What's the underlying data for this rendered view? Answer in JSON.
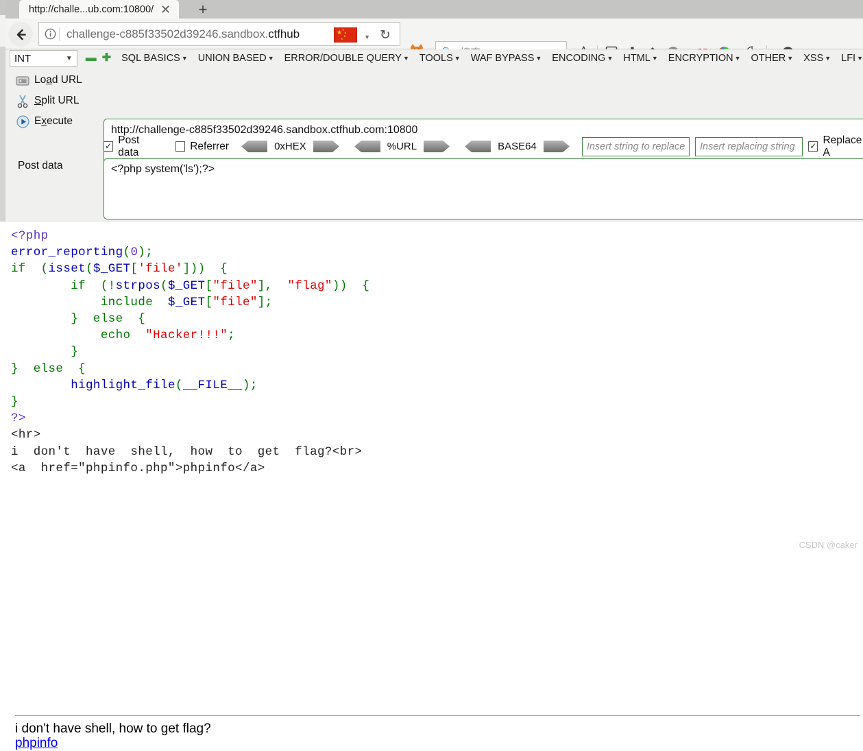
{
  "browser": {
    "tab": {
      "title": "http://challe...ub.com:10800/",
      "close_icon": "close-icon",
      "new_tab_icon": "plus-icon"
    },
    "nav": {
      "back_icon": "back-arrow-icon",
      "info_icon": "info-circle-icon",
      "url_prefix": "challenge-c885f33502d39246.sandbox.",
      "url_suffix": "ctfhub",
      "flag_icon": "china-flag-icon",
      "flag_caret": "chevron-down-icon",
      "reload_icon": "reload-icon",
      "hackbar_toggle_icon": "hackbar-fox-icon"
    },
    "search": {
      "icon": "search-icon",
      "placeholder": "搜索"
    },
    "toolbar_icons": [
      {
        "name": "bookmark-star-icon",
        "glyph": "☆"
      },
      {
        "name": "library-icon",
        "glyph": "▤"
      },
      {
        "name": "downloads-icon",
        "glyph": "⬇"
      },
      {
        "name": "home-icon",
        "glyph": "⌂"
      },
      {
        "name": "extension-gray-icon",
        "glyph": "●"
      },
      {
        "name": "js-switch-icon",
        "glyph": "JS"
      },
      {
        "name": "firebug-icon",
        "glyph": "●"
      },
      {
        "name": "cookie-manager-icon",
        "glyph": "○"
      },
      {
        "name": "proxy-switch-icon",
        "glyph": "●"
      }
    ]
  },
  "hackbar": {
    "type_select": {
      "value": "INT",
      "caret_icon": "chevron-down-icon"
    },
    "minus_icon": "minus-icon",
    "plus_icon": "plus-icon",
    "menu": [
      {
        "label": "SQL BASICS",
        "caret": "▾"
      },
      {
        "label": "UNION BASED",
        "caret": "▾"
      },
      {
        "label": "ERROR/DOUBLE QUERY",
        "caret": "▾"
      },
      {
        "label": "TOOLS",
        "caret": "▾"
      },
      {
        "label": "WAF BYPASS",
        "caret": "▾"
      },
      {
        "label": "ENCODING",
        "caret": "▾"
      },
      {
        "label": "HTML",
        "caret": "▾"
      },
      {
        "label": "ENCRYPTION",
        "caret": "▾"
      },
      {
        "label": "OTHER",
        "caret": "▾"
      },
      {
        "label": "XSS",
        "caret": "▾"
      },
      {
        "label": "LFI",
        "caret": "▾"
      }
    ],
    "side_actions": [
      {
        "icon": "load-url-icon",
        "pre": "Lo",
        "accel": "a",
        "post": "d URL"
      },
      {
        "icon": "split-url-scissors-icon",
        "pre": "",
        "accel": "S",
        "post": "plit URL"
      },
      {
        "icon": "execute-play-icon",
        "pre": "E",
        "accel": "x",
        "post": "ecute"
      }
    ],
    "url_value": "http://challenge-c885f33502d39246.sandbox.ctfhub.com:10800",
    "options": {
      "post_data": {
        "label": "Post data",
        "checked": true
      },
      "referrer": {
        "label": "Referrer",
        "checked": false
      },
      "encoders": [
        "0xHEX",
        "%URL",
        "BASE64"
      ],
      "replace_search": {
        "placeholder": "Insert string to replace"
      },
      "replace_with": {
        "placeholder": "Insert replacing string"
      },
      "replace_all": {
        "label": "Replace A",
        "checked": true
      }
    },
    "post_label": "Post data",
    "post_value": "<?php system('ls');?>"
  },
  "page": {
    "code_lines": [
      [
        {
          "t": "<?php",
          "c": "c-php"
        }
      ],
      [
        {
          "t": "error_reporting",
          "c": "c-fn"
        },
        {
          "t": "(",
          "c": "c-kw"
        },
        {
          "t": "0",
          "c": "c-php"
        },
        {
          "t": ")",
          "c": "c-kw"
        },
        {
          "t": ";",
          "c": "c-kw"
        }
      ],
      [
        {
          "t": "if",
          "c": "c-kw"
        },
        {
          "t": "  (",
          "c": "c-kw"
        },
        {
          "t": "isset",
          "c": "c-fn"
        },
        {
          "t": "(",
          "c": "c-kw"
        },
        {
          "t": "$_GET",
          "c": "c-var"
        },
        {
          "t": "[",
          "c": "c-kw"
        },
        {
          "t": "'file'",
          "c": "c-str"
        },
        {
          "t": "]))  {",
          "c": "c-kw"
        }
      ],
      [
        {
          "t": "        if  (!",
          "c": "c-kw"
        },
        {
          "t": "strpos",
          "c": "c-fn"
        },
        {
          "t": "(",
          "c": "c-kw"
        },
        {
          "t": "$_GET",
          "c": "c-var"
        },
        {
          "t": "[",
          "c": "c-kw"
        },
        {
          "t": "\"file\"",
          "c": "c-str"
        },
        {
          "t": "],  ",
          "c": "c-kw"
        },
        {
          "t": "\"flag\"",
          "c": "c-str"
        },
        {
          "t": "))  {",
          "c": "c-kw"
        }
      ],
      [
        {
          "t": "            include  ",
          "c": "c-kw"
        },
        {
          "t": "$_GET",
          "c": "c-var"
        },
        {
          "t": "[",
          "c": "c-kw"
        },
        {
          "t": "\"file\"",
          "c": "c-str"
        },
        {
          "t": "];",
          "c": "c-kw"
        }
      ],
      [
        {
          "t": "        }  else  {",
          "c": "c-kw"
        }
      ],
      [
        {
          "t": "            echo  ",
          "c": "c-kw"
        },
        {
          "t": "\"Hacker!!!\"",
          "c": "c-str"
        },
        {
          "t": ";",
          "c": "c-kw"
        }
      ],
      [
        {
          "t": "        }",
          "c": "c-kw"
        }
      ],
      [
        {
          "t": "}  else  {",
          "c": "c-kw"
        }
      ],
      [
        {
          "t": "        ",
          "c": "c-kw"
        },
        {
          "t": "highlight_file",
          "c": "c-fn"
        },
        {
          "t": "(",
          "c": "c-kw"
        },
        {
          "t": "__FILE__",
          "c": "c-var"
        },
        {
          "t": ")",
          "c": "c-kw"
        },
        {
          "t": ";",
          "c": "c-kw"
        }
      ],
      [
        {
          "t": "}",
          "c": "c-kw"
        }
      ],
      [
        {
          "t": "?>",
          "c": "c-php"
        }
      ],
      [
        {
          "t": "<hr>",
          "c": "c-html"
        }
      ],
      [
        {
          "t": "i  don't  have  shell,  how  to  get  flag?<br>",
          "c": "c-html"
        }
      ],
      [
        {
          "t": "<a  href=\"phpinfo.php\">phpinfo</a>",
          "c": "c-html"
        }
      ]
    ],
    "output_text": "i don't have shell, how to get flag?",
    "output_link": "phpinfo"
  },
  "watermark": "CSDN @caker"
}
